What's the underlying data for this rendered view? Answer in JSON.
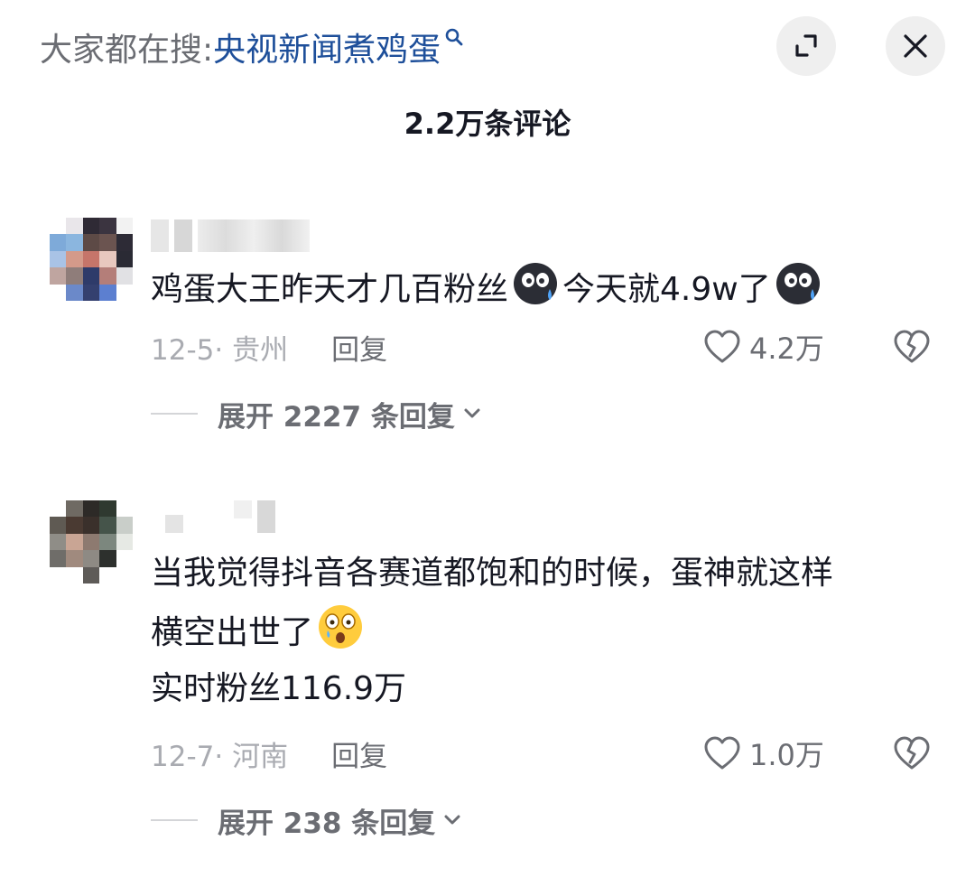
{
  "header": {
    "search_prefix": "大家都在搜:",
    "search_query": "央视新闻煮鸡蛋",
    "comment_count": "2.2万条评论"
  },
  "comments": [
    {
      "text_before": "鸡蛋大王昨天才几百粉丝",
      "text_mid": "今天就4.9w了",
      "date_location": "12-5· 贵州",
      "reply_label": "回复",
      "likes": "4.2万",
      "expand_label": "展开 2227 条回复"
    },
    {
      "line1": "当我觉得抖音各赛道都饱和的时候，蛋神就这样",
      "line2": "横空出世了",
      "line3": "实时粉丝116.9万",
      "date_location": "12-7· 河南",
      "reply_label": "回复",
      "likes": "1.0万",
      "expand_label": "展开 238 条回复"
    }
  ],
  "icons": {
    "expand": "expand-icon",
    "close": "close-icon",
    "like": "heart-icon",
    "dislike": "broken-heart-icon",
    "emoji1": "sweat-emoji-icon",
    "emoji2": "shocked-emoji-icon"
  },
  "colors": {
    "link": "#1e4f9a",
    "text": "#161823",
    "muted": "#a9abb1",
    "secondary": "#6b6d73"
  }
}
